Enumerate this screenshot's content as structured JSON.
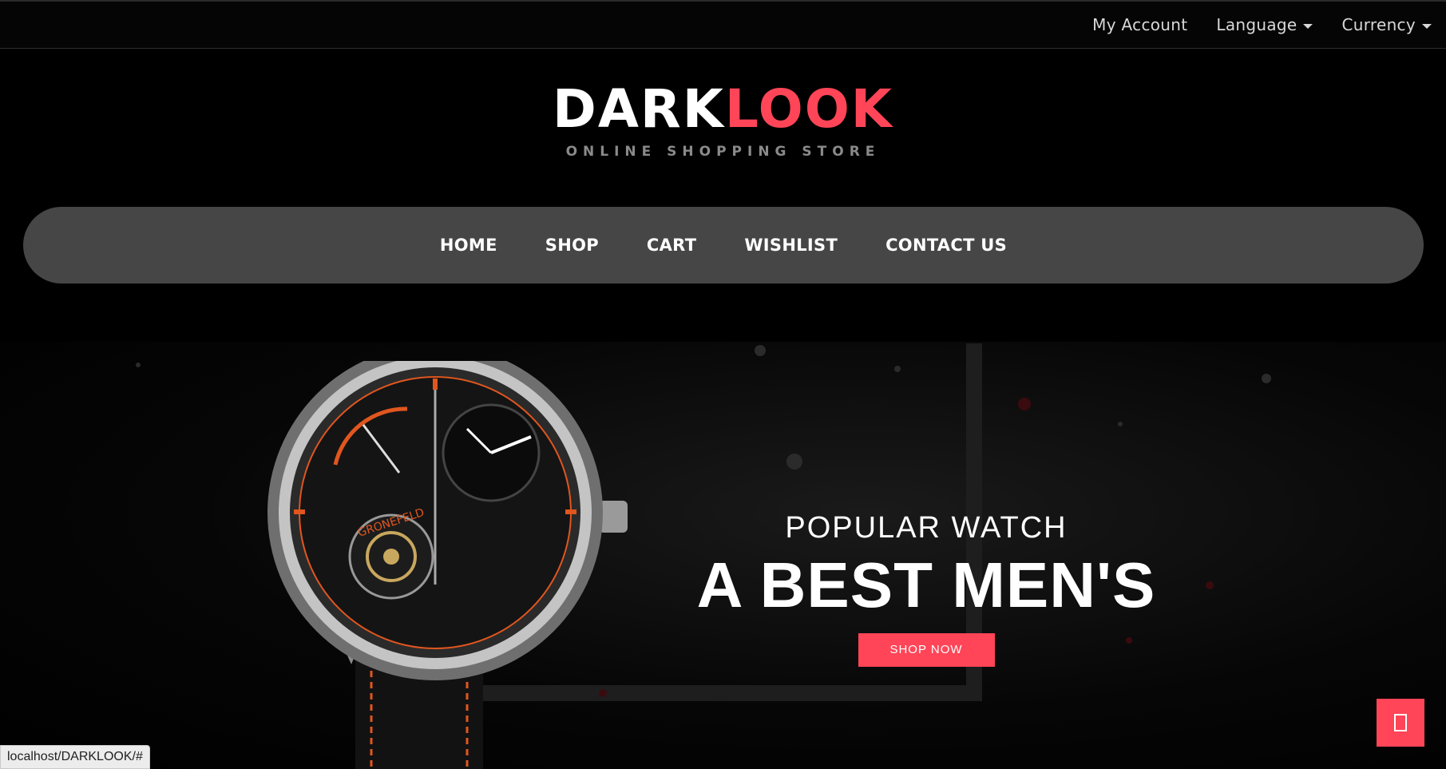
{
  "topbar": {
    "my_account": "My Account",
    "language": "Language",
    "currency": "Currency"
  },
  "logo": {
    "part1": "DARK",
    "part2": "LOOK",
    "tagline": "ONLINE SHOPPING STORE"
  },
  "nav": {
    "items": [
      {
        "label": "HOME"
      },
      {
        "label": "SHOP"
      },
      {
        "label": "CART"
      },
      {
        "label": "WISHLIST"
      },
      {
        "label": "CONTACT US"
      }
    ]
  },
  "hero": {
    "subtitle": "POPULAR WATCH",
    "title": "A BEST MEN'S",
    "cta": "SHOP NOW",
    "watch_brand": "GRONEFELD"
  },
  "status_url": "localhost/DARKLOOK/#",
  "colors": {
    "accent": "#ff4557",
    "nav_bg": "#464646",
    "page_bg": "#000000"
  },
  "icons": {
    "floating_button": "bookmark-icon"
  }
}
